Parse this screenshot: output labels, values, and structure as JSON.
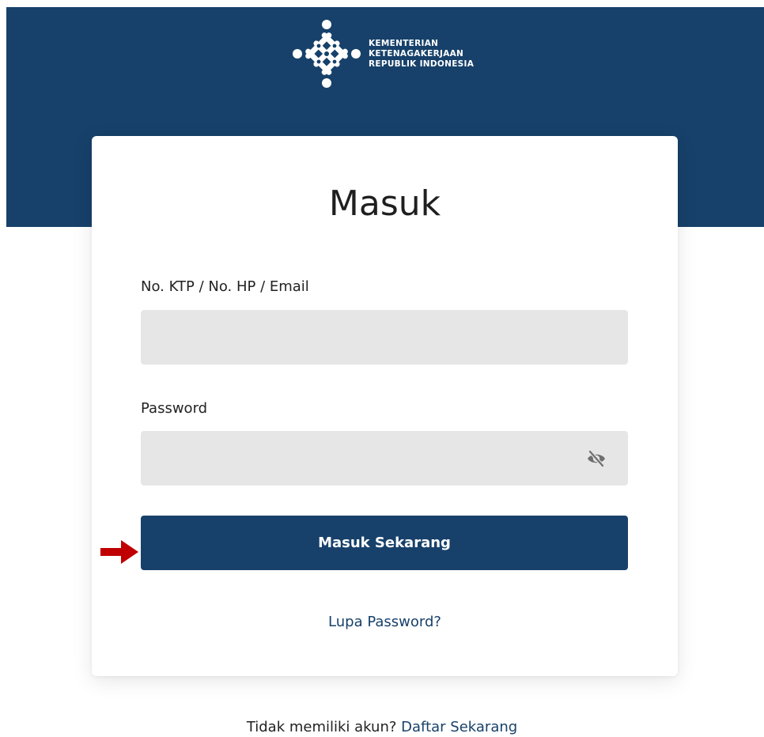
{
  "header": {
    "logo_lines": [
      "KEMENTERIAN",
      "KETENAGAKERJAAN",
      "REPUBLIK INDONESIA"
    ],
    "logo_icon": "ministry-emblem-icon",
    "background_color": "#17416a"
  },
  "login_form": {
    "title": "Masuk",
    "username_label": "No. KTP / No. HP / Email",
    "username_value": "",
    "password_label": "Password",
    "password_value": "",
    "password_toggle_icon": "eye-slash-icon",
    "submit_label": "Masuk Sekarang",
    "forgot_label": "Lupa Password?"
  },
  "annotation": {
    "arrow_icon": "red-arrow-right-icon",
    "arrow_color": "#c00000"
  },
  "footer": {
    "signup_prompt": "Tidak memiliki akun?",
    "signup_link": "Daftar Sekarang"
  },
  "colors": {
    "primary": "#17416a",
    "input_bg": "#e6e6e6"
  }
}
